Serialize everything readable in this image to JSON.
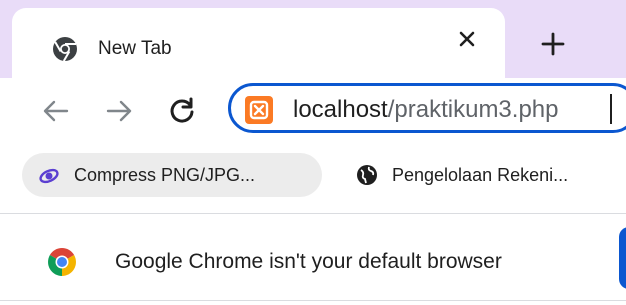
{
  "tab": {
    "title": "New Tab",
    "favicon": "chrome-favicon-icon"
  },
  "toolbar": {
    "url_host": "localhost",
    "url_path": "/praktikum3.php",
    "site_icon": "xampp-icon"
  },
  "bookmarks": [
    {
      "label": "Compress PNG/JPG...",
      "icon": "compress-icon"
    },
    {
      "label": "Pengelolaan Rekeni...",
      "icon": "globe-icon"
    }
  ],
  "infobar": {
    "message": "Google Chrome isn't your default browser"
  },
  "colors": {
    "tabstrip_bg": "#e9dcf8",
    "focus_ring": "#0b57d0",
    "site_icon": "#fb7a24",
    "text": "#1f1f1f"
  }
}
